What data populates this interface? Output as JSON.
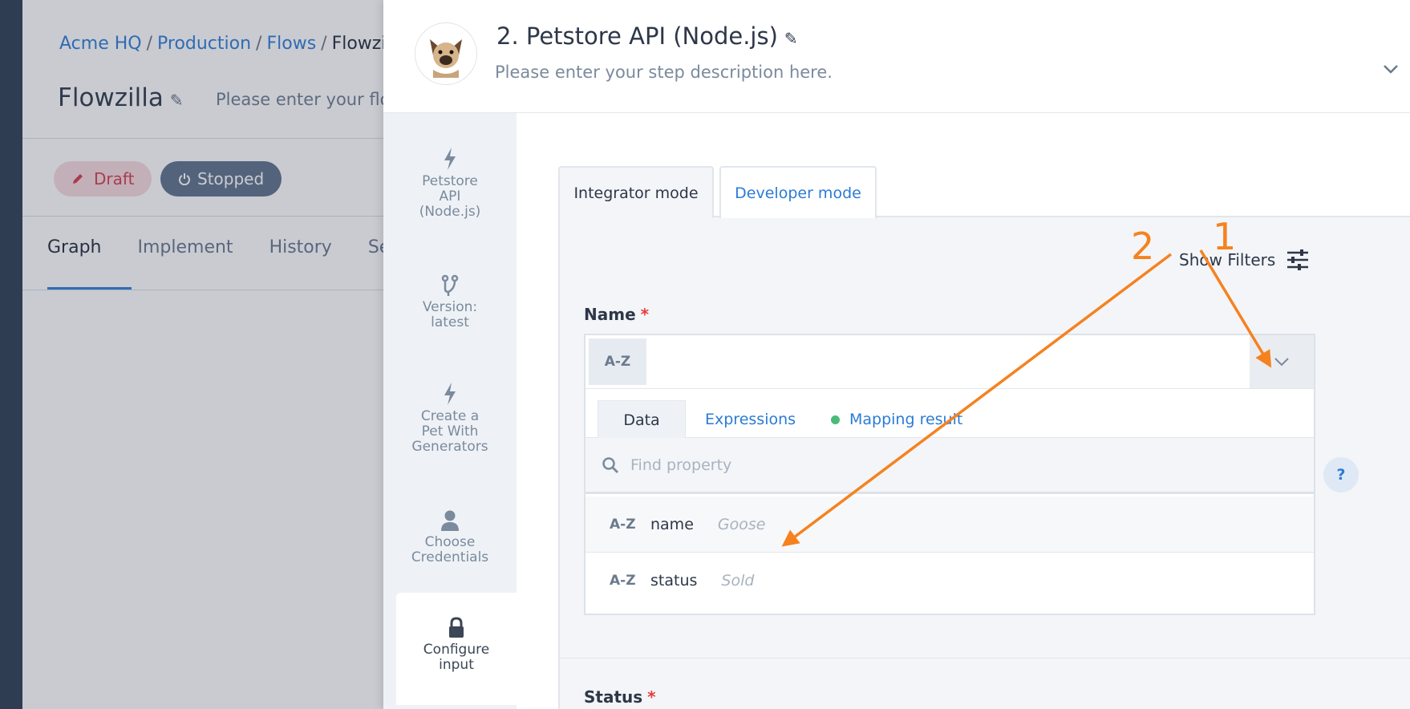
{
  "flow_page": {
    "breadcrumb": [
      "Acme HQ",
      "Production",
      "Flows",
      "Flowzi"
    ],
    "title": "Flowzilla",
    "description": "Please enter your flow",
    "draft_label": "Draft",
    "stopped_label": "Stopped",
    "tabs": [
      "Graph",
      "Implement",
      "History",
      "Se"
    ]
  },
  "drawer": {
    "title": "2. Petstore API (Node.js)",
    "description": "Please enter your step description here."
  },
  "steps": [
    {
      "label_lines": [
        "Petstore",
        "API",
        "(Node.js)"
      ],
      "icon": "bolt-icon"
    },
    {
      "label_lines": [
        "Version:",
        "latest"
      ],
      "icon": "branch-icon"
    },
    {
      "label_lines": [
        "Create a",
        "Pet With",
        "Generators"
      ],
      "icon": "bolt-icon"
    },
    {
      "label_lines": [
        "Choose",
        "Credentials"
      ],
      "icon": "user-icon"
    },
    {
      "label_lines": [
        "Configure",
        "input"
      ],
      "icon": "lock-icon"
    }
  ],
  "modes": {
    "integrator": "Integrator mode",
    "developer": "Developer mode"
  },
  "show_filters": "Show Filters",
  "name_field": {
    "label": "Name",
    "required_mark": "*",
    "type_chip": "A-Z",
    "tabs": [
      "Data",
      "Expressions",
      "Mapping result"
    ],
    "search_placeholder": "Find property",
    "properties": [
      {
        "type": "A-Z",
        "key": "name",
        "sample": "Goose"
      },
      {
        "type": "A-Z",
        "key": "status",
        "sample": "Sold"
      }
    ]
  },
  "status_field": {
    "label": "Status",
    "required_mark": "*"
  },
  "help_label": "?",
  "annotations": {
    "marker_1": "1",
    "marker_2": "2",
    "color": "#f5821f"
  },
  "colors": {
    "accent": "#2b7bd6",
    "draft": "#d23a4a",
    "required": "#e53e3e",
    "status_dot": "#48bb78"
  }
}
